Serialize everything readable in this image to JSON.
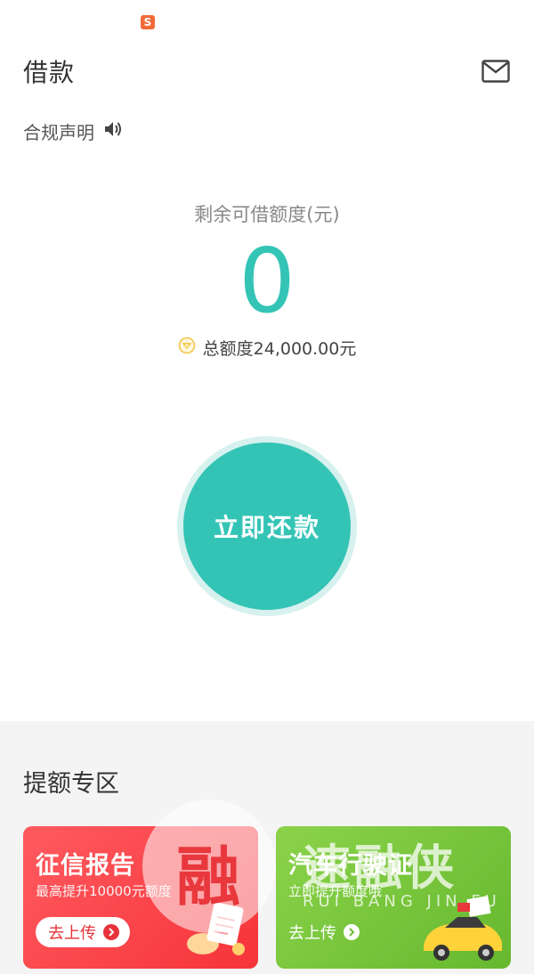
{
  "status_bar": {
    "app_icon": "s-logo-icon",
    "app_icon_char": "S"
  },
  "header": {
    "title": "借款",
    "mail_icon": "mail-icon"
  },
  "compliance": {
    "label": "合规声明",
    "icon": "speaker-icon"
  },
  "credit": {
    "available_label": "剩余可借额度(元)",
    "available_amount": "0",
    "total_text": "总额度24,000.00元",
    "accent_color": "#34c4b6"
  },
  "repay": {
    "label": "立即还款"
  },
  "boost": {
    "section_title": "提额专区",
    "cards": [
      {
        "title": "征信报告",
        "subtitle": "最高提升10000元额度",
        "button": "去上传",
        "color": "#f5343a"
      },
      {
        "title": "汽车行驶证",
        "subtitle": "立即提升额度哦",
        "button": "去上传",
        "color": "#6cbc33"
      }
    ]
  },
  "watermark": {
    "char": "融",
    "brand": "速融侠",
    "pinyin": "RUI BANG JIN FU"
  }
}
